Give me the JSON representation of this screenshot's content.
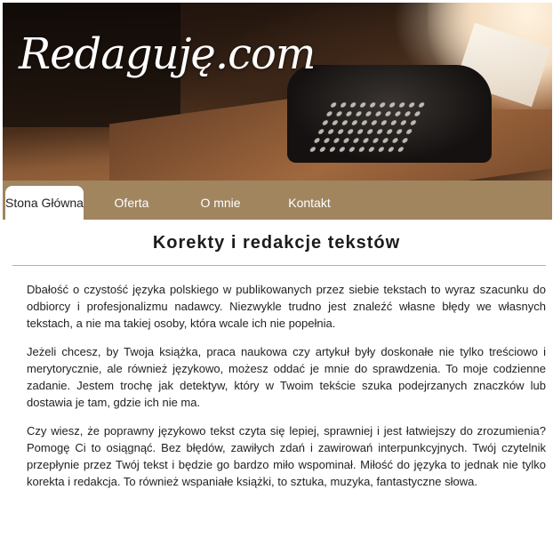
{
  "header": {
    "logo_text": "Redaguję.com"
  },
  "nav": {
    "tabs": [
      {
        "label": "Stona Główna",
        "active": true
      },
      {
        "label": "Oferta",
        "active": false
      },
      {
        "label": "O mnie",
        "active": false
      },
      {
        "label": "Kontakt",
        "active": false
      }
    ]
  },
  "main": {
    "title": "Korekty i redakcje tekstów",
    "paragraphs": [
      "Dbałość o czystość języka polskiego w publikowanych przez siebie tekstach to wyraz szacunku do odbiorcy i profesjonalizmu nadawcy. Niezwykle trudno jest znaleźć własne błędy we własnych tekstach, a nie ma takiej osoby, która wcale ich nie popełnia.",
      "Jeżeli chcesz, by Twoja książka, praca naukowa czy artykuł były doskonałe nie tylko treściowo i merytorycznie, ale również językowo, możesz oddać je mnie do sprawdzenia. To moje codzienne zadanie. Jestem trochę jak detektyw, który w Twoim tekście szuka podejrzanych znaczków lub dostawia je tam, gdzie ich nie ma.",
      "Czy wiesz, że poprawny językowo tekst czyta się lepiej, sprawniej i jest łatwiejszy do zrozumienia? Pomogę Ci to osiągnąć. Bez błędów, zawiłych zdań i zawirowań interpunkcyjnych. Twój czytelnik przepłynie przez Twój tekst i będzie go bardzo miło wspominał. Miłość do języka to jednak nie tylko korekta i redakcja. To również wspaniałe książki, to sztuka, muzyka, fantastyczne słowa."
    ]
  },
  "colors": {
    "nav_bg": "#a0855f",
    "divider": "#b0b0b0"
  }
}
